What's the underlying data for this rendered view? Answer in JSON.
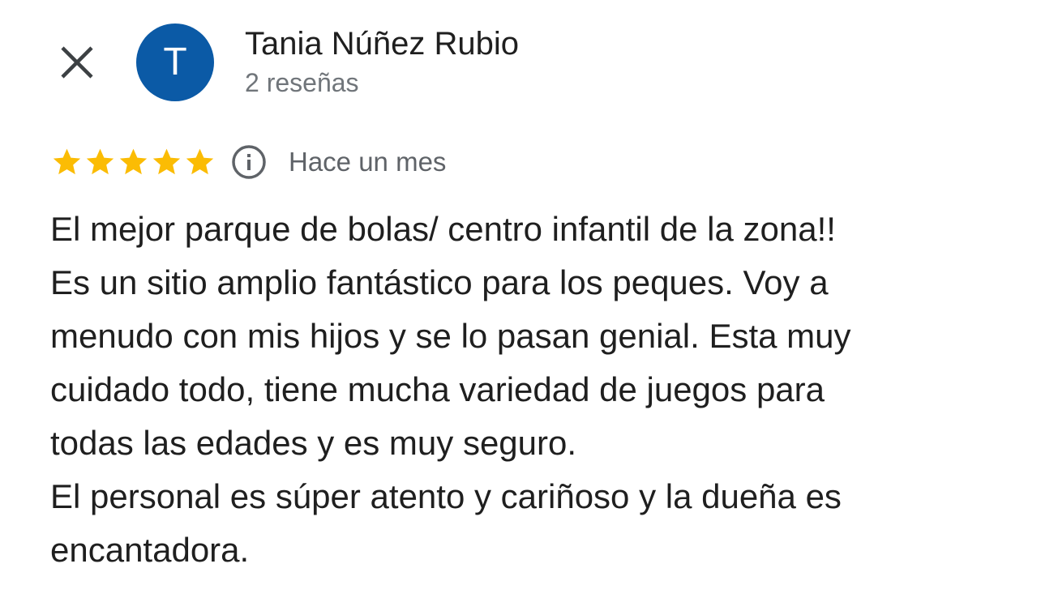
{
  "header": {
    "close_icon": "close-icon",
    "avatar_letter": "T",
    "avatar_color": "#0b5aa6",
    "author_name": "Tania Núñez Rubio",
    "author_meta": "2 reseñas"
  },
  "rating": {
    "stars": 5,
    "max_stars": 5,
    "star_color": "#fbbc04",
    "info_icon": "info-icon",
    "time": "Hace un mes"
  },
  "review": {
    "text": "El mejor parque de bolas/ centro infantil de la zona!!\nEs un sitio amplio fantástico para los peques. Voy a\nmenudo con mis hijos y se lo pasan genial. Esta muy\ncuidado todo, tiene mucha variedad de juegos para\ntodas las edades y es muy seguro.\nEl personal es súper atento y cariñoso y la dueña es\nencantadora."
  }
}
